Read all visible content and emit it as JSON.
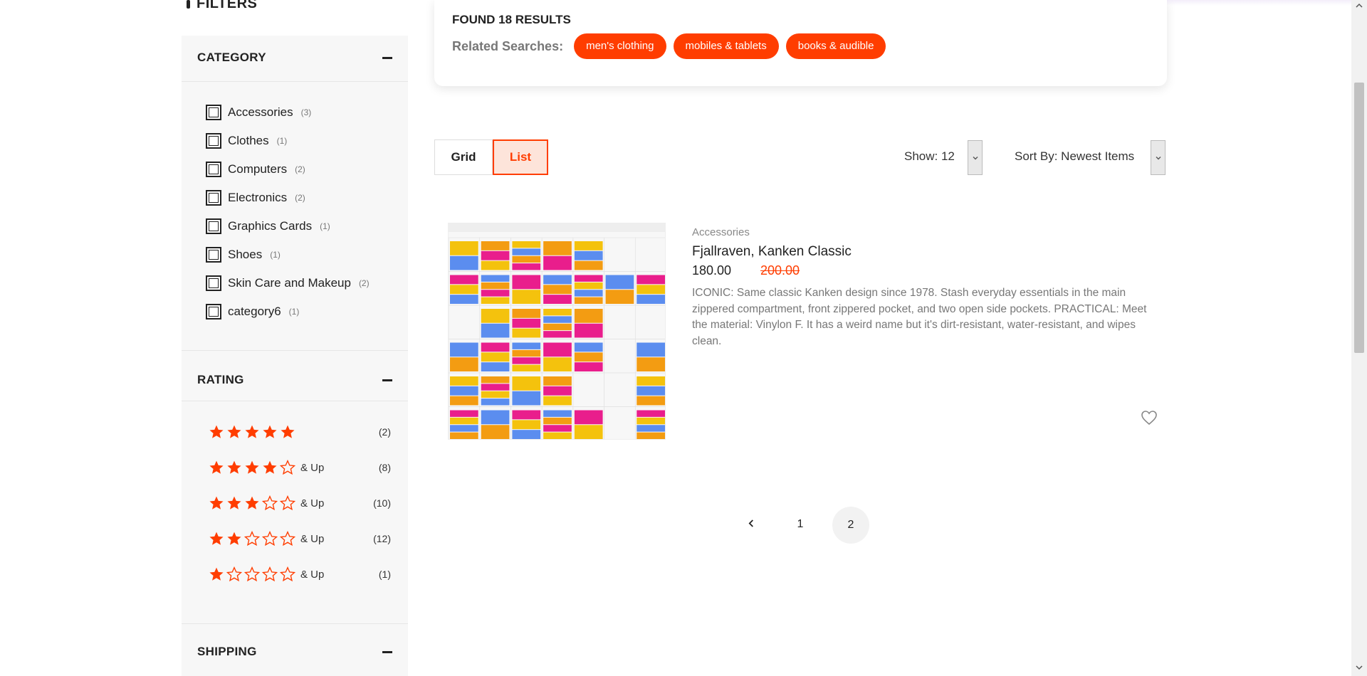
{
  "sidebar": {
    "title": "FILTERS",
    "category": {
      "title": "CATEGORY",
      "items": [
        {
          "label": "Accessories",
          "count": "(3)"
        },
        {
          "label": "Clothes",
          "count": "(1)"
        },
        {
          "label": "Computers",
          "count": "(2)"
        },
        {
          "label": "Electronics",
          "count": "(2)"
        },
        {
          "label": "Graphics Cards",
          "count": "(1)"
        },
        {
          "label": "Shoes",
          "count": "(1)"
        },
        {
          "label": "Skin Care and Makeup",
          "count": "(2)"
        },
        {
          "label": "category6",
          "count": "(1)"
        }
      ]
    },
    "rating": {
      "title": "RATING",
      "and_up": "& Up",
      "rows": [
        {
          "stars": 5,
          "suffix": "",
          "count": "(2)"
        },
        {
          "stars": 4,
          "suffix": "& Up",
          "count": "(8)"
        },
        {
          "stars": 3,
          "suffix": "& Up",
          "count": "(10)"
        },
        {
          "stars": 2,
          "suffix": "& Up",
          "count": "(12)"
        },
        {
          "stars": 1,
          "suffix": "& Up",
          "count": "(1)"
        }
      ]
    },
    "shipping": {
      "title": "SHIPPING"
    }
  },
  "results": {
    "found": "FOUND 18 RESULTS",
    "related_label": "Related Searches:",
    "tags": [
      "men's clothing",
      "mobiles & tablets",
      "books & audible"
    ]
  },
  "toolbar": {
    "grid_label": "Grid",
    "list_label": "List",
    "active_view": "List",
    "show_label": "Show: 12",
    "sort_label": "Sort By: Newest Items"
  },
  "product": {
    "category": "Accessories",
    "title": "Fjallraven, Kanken Classic",
    "price": "180.00",
    "old_price": "200.00",
    "description": "ICONIC: Same classic Kanken design since 1978. Stash everyday essentials in the main zippered compartment, front zippered pocket, and two open side pockets. PRACTICAL: Meet the material: Vinylon F. It has a weird name but it's dirt-resistant, water-resistant, and wipes clean.",
    "image_icon": "calendar-screenshot-image",
    "wishlist_icon": "heart-icon"
  },
  "pagination": {
    "prev_icon": "chevron-left-icon",
    "page_one": "1",
    "page_two": "2",
    "current": "2"
  },
  "colors": {
    "accent": "#ff3d00",
    "sidebar_bg": "#f7f7f7",
    "star": "#ff3d00"
  }
}
